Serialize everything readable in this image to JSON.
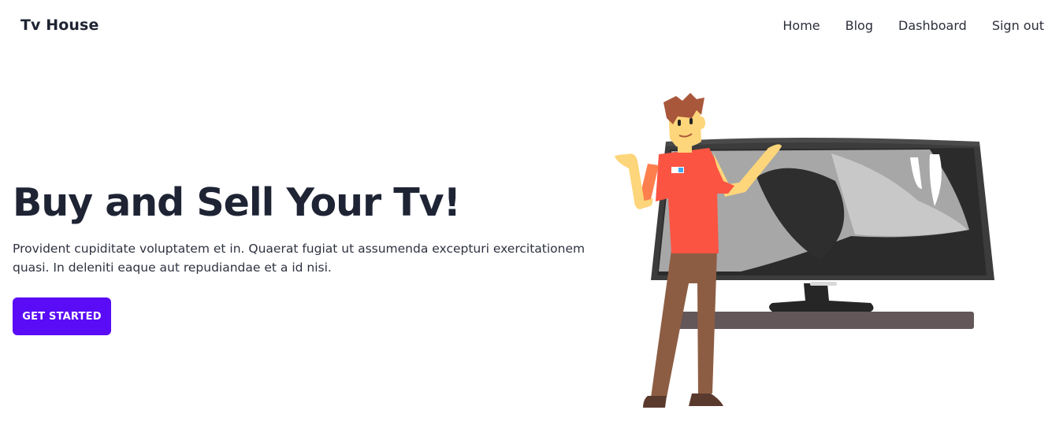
{
  "navbar": {
    "brand": "Tv House",
    "links": [
      {
        "label": "Home"
      },
      {
        "label": "Blog"
      },
      {
        "label": "Dashboard"
      },
      {
        "label": "Sign out"
      }
    ]
  },
  "hero": {
    "title": "Buy and Sell Your Tv!",
    "description": "Provident cupiditate voluptatem et in. Quaerat fugiat ut assumenda excepturi exercitationem quasi. In deleniti eaque aut repudiandae et a id nisi.",
    "cta_label": "GET STARTED"
  },
  "colors": {
    "accent": "#5a0cf6",
    "heading": "#1e2434",
    "tv_shelf": "#63575a",
    "shirt": "#fb5442"
  },
  "illustration": {
    "icon": "salesman-with-tv-illustration"
  }
}
